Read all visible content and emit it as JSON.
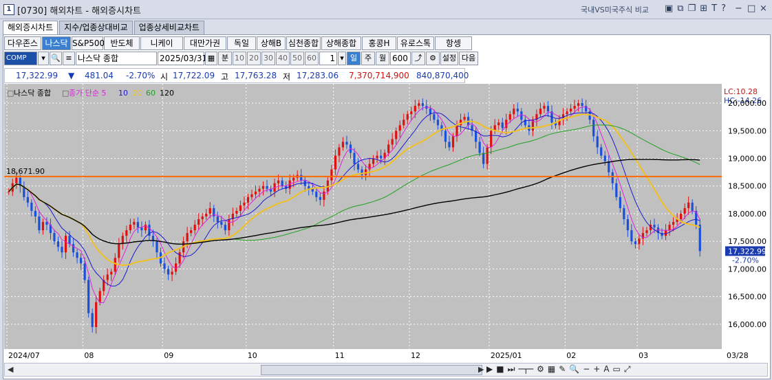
{
  "window": {
    "app_number": "1",
    "title": "[0730] 해외차트 - 해외증시차트",
    "compare_label": "국내VS미국주식 비교",
    "tool_icons": [
      "layout-icon",
      "window-icon",
      "copy-icon",
      "pin-icon",
      "text-icon",
      "help-icon"
    ],
    "minimize": "−",
    "maximize": "□",
    "close": "×"
  },
  "tabs": [
    "해외증시차트",
    "지수/업종상대비교",
    "업종상세비교차트"
  ],
  "index_buttons": [
    "다우존스",
    "나스닥",
    "S&P500",
    "반도체",
    "니케이",
    "대만가권",
    "독일",
    "상해B",
    "심천종합",
    "상해종합",
    "홍콩H",
    "유로스톡",
    "항셍"
  ],
  "controls": {
    "code": "COMP",
    "name": "나스닥 종합",
    "date": "2025/03/31",
    "minute_label": "분",
    "periods": [
      "10",
      "20",
      "30",
      "40",
      "50",
      "60"
    ],
    "count_value": "1",
    "day_label": "일",
    "week_label": "주",
    "month_label": "월",
    "bar_count": "600",
    "settings_label": "설정",
    "next_label": "다음"
  },
  "quote": {
    "price": "17,322.99",
    "change": "481.04",
    "change_pct": "-2.70%",
    "open_label": "시",
    "open": "17,722.09",
    "high_label": "고",
    "high": "17,763.28",
    "low_label": "저",
    "low": "17,283.06",
    "volume": "7,370,714,900",
    "amount": "840,870,400"
  },
  "chart_data": {
    "type": "line",
    "title": "나스닥 종합",
    "legend": [
      {
        "label": "종가 단순 5",
        "color": "#e020e0"
      },
      {
        "label": "10",
        "color": "#1a1ad0"
      },
      {
        "label": "20",
        "color": "#f0c020"
      },
      {
        "label": "60",
        "color": "#20a020"
      },
      {
        "label": "120",
        "color": "#000000"
      }
    ],
    "ylim": [
      15600,
      20200
    ],
    "y_ticks": [
      "20,000.00",
      "19,500.00",
      "19,000.00",
      "18,500.00",
      "18,000.00",
      "17,500.00",
      "17,000.00",
      "16,500.00",
      "16,000.00"
    ],
    "y_tick_values": [
      20000,
      19500,
      19000,
      18500,
      18000,
      17500,
      17000,
      16500,
      16000
    ],
    "x_labels": [
      "2024/07",
      "08",
      "09",
      "10",
      "11",
      "12",
      "2025/01",
      "02",
      "03",
      "03/28"
    ],
    "x_label_index": [
      0,
      20,
      41,
      63,
      86,
      106,
      127,
      147,
      166,
      186
    ],
    "lc": "LC:10.28",
    "hc": "HC:-14.26",
    "hline_label": "18,671.90",
    "hline_value": 18671.9,
    "last_price": "17,322.99",
    "last_pct": "-2.70%",
    "closes": [
      18400,
      18550,
      18650,
      18500,
      18300,
      18200,
      18050,
      17950,
      17700,
      17850,
      17800,
      17650,
      17500,
      17400,
      17300,
      17600,
      17450,
      17300,
      17200,
      17100,
      16800,
      16200,
      15950,
      16400,
      16600,
      16800,
      16900,
      16950,
      17200,
      17450,
      17600,
      17700,
      17800,
      17850,
      17750,
      17700,
      17800,
      17600,
      17500,
      17300,
      17100,
      17000,
      16900,
      16950,
      17100,
      17300,
      17500,
      17650,
      17700,
      17800,
      17900,
      17950,
      18000,
      18100,
      17950,
      17850,
      17800,
      17700,
      17900,
      18000,
      18050,
      18150,
      18200,
      18300,
      18350,
      18400,
      18450,
      18500,
      18450,
      18400,
      18550,
      18600,
      18500,
      18450,
      18600,
      18650,
      18700,
      18600,
      18500,
      18450,
      18400,
      18300,
      18250,
      18400,
      18600,
      18800,
      19050,
      19200,
      19300,
      19250,
      19100,
      18900,
      18800,
      18700,
      18800,
      18900,
      19000,
      19050,
      19000,
      19100,
      19250,
      19350,
      19500,
      19600,
      19700,
      19800,
      19850,
      19950,
      20000,
      19950,
      19900,
      19800,
      19700,
      19600,
      19500,
      19300,
      19200,
      19400,
      19600,
      19700,
      19750,
      19600,
      19500,
      19300,
      19100,
      18900,
      19200,
      19500,
      19600,
      19650,
      19550,
      19700,
      19800,
      19900,
      19850,
      19700,
      19600,
      19500,
      19700,
      19800,
      19900,
      19950,
      19850,
      19650,
      19600,
      19700,
      19800,
      19850,
      19900,
      19950,
      20000,
      19950,
      19850,
      19700,
      19400,
      19200,
      19050,
      18950,
      18750,
      18550,
      18300,
      18100,
      17900,
      17700,
      17500,
      17450,
      17550,
      17650,
      17700,
      17800,
      17750,
      17650,
      17600,
      17700,
      17800,
      17850,
      17900,
      18000,
      18100,
      18200,
      18050,
      17800,
      17322.99
    ]
  },
  "scrollbar": {
    "left_arrow": "◀",
    "right_arrow": "▶",
    "tools": [
      "play-icon",
      "stop-icon",
      "fast-forward-icon",
      "zoom-slider-icon",
      "settings-icon",
      "search-icon",
      "zoom-in-icon",
      "text-size-icon"
    ]
  }
}
